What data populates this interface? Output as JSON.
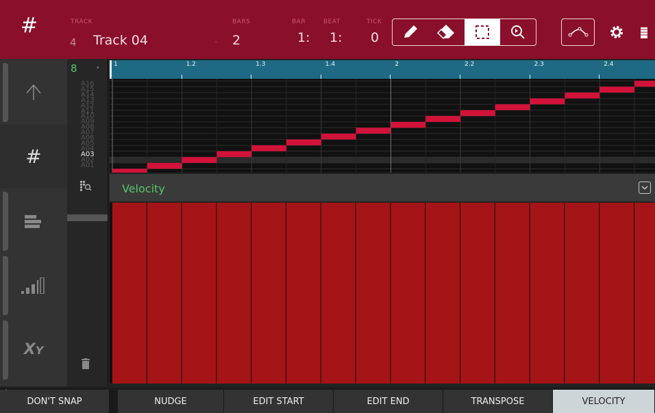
{
  "colors": {
    "header_bg": "#8a0f2a",
    "accent_red": "#c4122b",
    "note_red": "#d3123a",
    "velocity_red": "#a51417",
    "ruler_blue": "#1e6a85",
    "label_green": "#55c56a"
  },
  "header": {
    "menu_icon": "grid-icon",
    "track_label": "TRACK",
    "track_number": "4",
    "track_name": "Track 04",
    "bars_label": "BARS",
    "bars_value": "2",
    "bar_label": "BAR",
    "bar_value": "1:",
    "beat_label": "BEAT",
    "beat_value": "1:",
    "tick_label": "TICK",
    "tick_value": "0",
    "tools": [
      {
        "name": "pencil-icon",
        "active": false
      },
      {
        "name": "eraser-icon",
        "active": false
      },
      {
        "name": "select-icon",
        "active": true
      },
      {
        "name": "zoom-icon",
        "active": false
      }
    ],
    "automation_icon": "automation-icon",
    "settings_icon": "gear-icon",
    "battery_icon": "battery-icon"
  },
  "leftnav": {
    "items": [
      {
        "name": "up-arrow-icon",
        "active": false
      },
      {
        "name": "grid-icon",
        "active": true
      },
      {
        "name": "bars-icon",
        "active": false
      },
      {
        "name": "level-icon",
        "active": false
      },
      {
        "name": "xy-icon",
        "active": false
      }
    ]
  },
  "notecol": {
    "grid_value": "8",
    "notes": [
      "A16",
      "A15",
      "A14",
      "A13",
      "A12",
      "A11",
      "A10",
      "A09",
      "A08",
      "A07",
      "A06",
      "A05",
      "A04",
      "A03",
      "A02",
      "A01"
    ],
    "highlighted_note": "A03"
  },
  "timeline": {
    "labels": [
      "1",
      "1.2",
      "1.3",
      "1.4",
      "2",
      "2.2",
      "2.3",
      "2.4"
    ]
  },
  "sequence": {
    "steps": 16,
    "notes_per_step": [
      1,
      2,
      3,
      4,
      5,
      6,
      7,
      8,
      9,
      10,
      11,
      12,
      13,
      14,
      15,
      16
    ],
    "velocities": [
      127,
      127,
      127,
      127,
      127,
      127,
      127,
      127,
      127,
      127,
      127,
      127,
      127,
      127,
      127,
      127
    ]
  },
  "velocity_lane": {
    "title": "Velocity"
  },
  "bottombar": {
    "buttons": [
      {
        "label": "DON'T SNAP",
        "active": false
      },
      {
        "label": "NUDGE",
        "active": false
      },
      {
        "label": "EDIT START",
        "active": false
      },
      {
        "label": "EDIT END",
        "active": false
      },
      {
        "label": "TRANSPOSE",
        "active": false
      },
      {
        "label": "VELOCITY",
        "active": true
      }
    ]
  }
}
